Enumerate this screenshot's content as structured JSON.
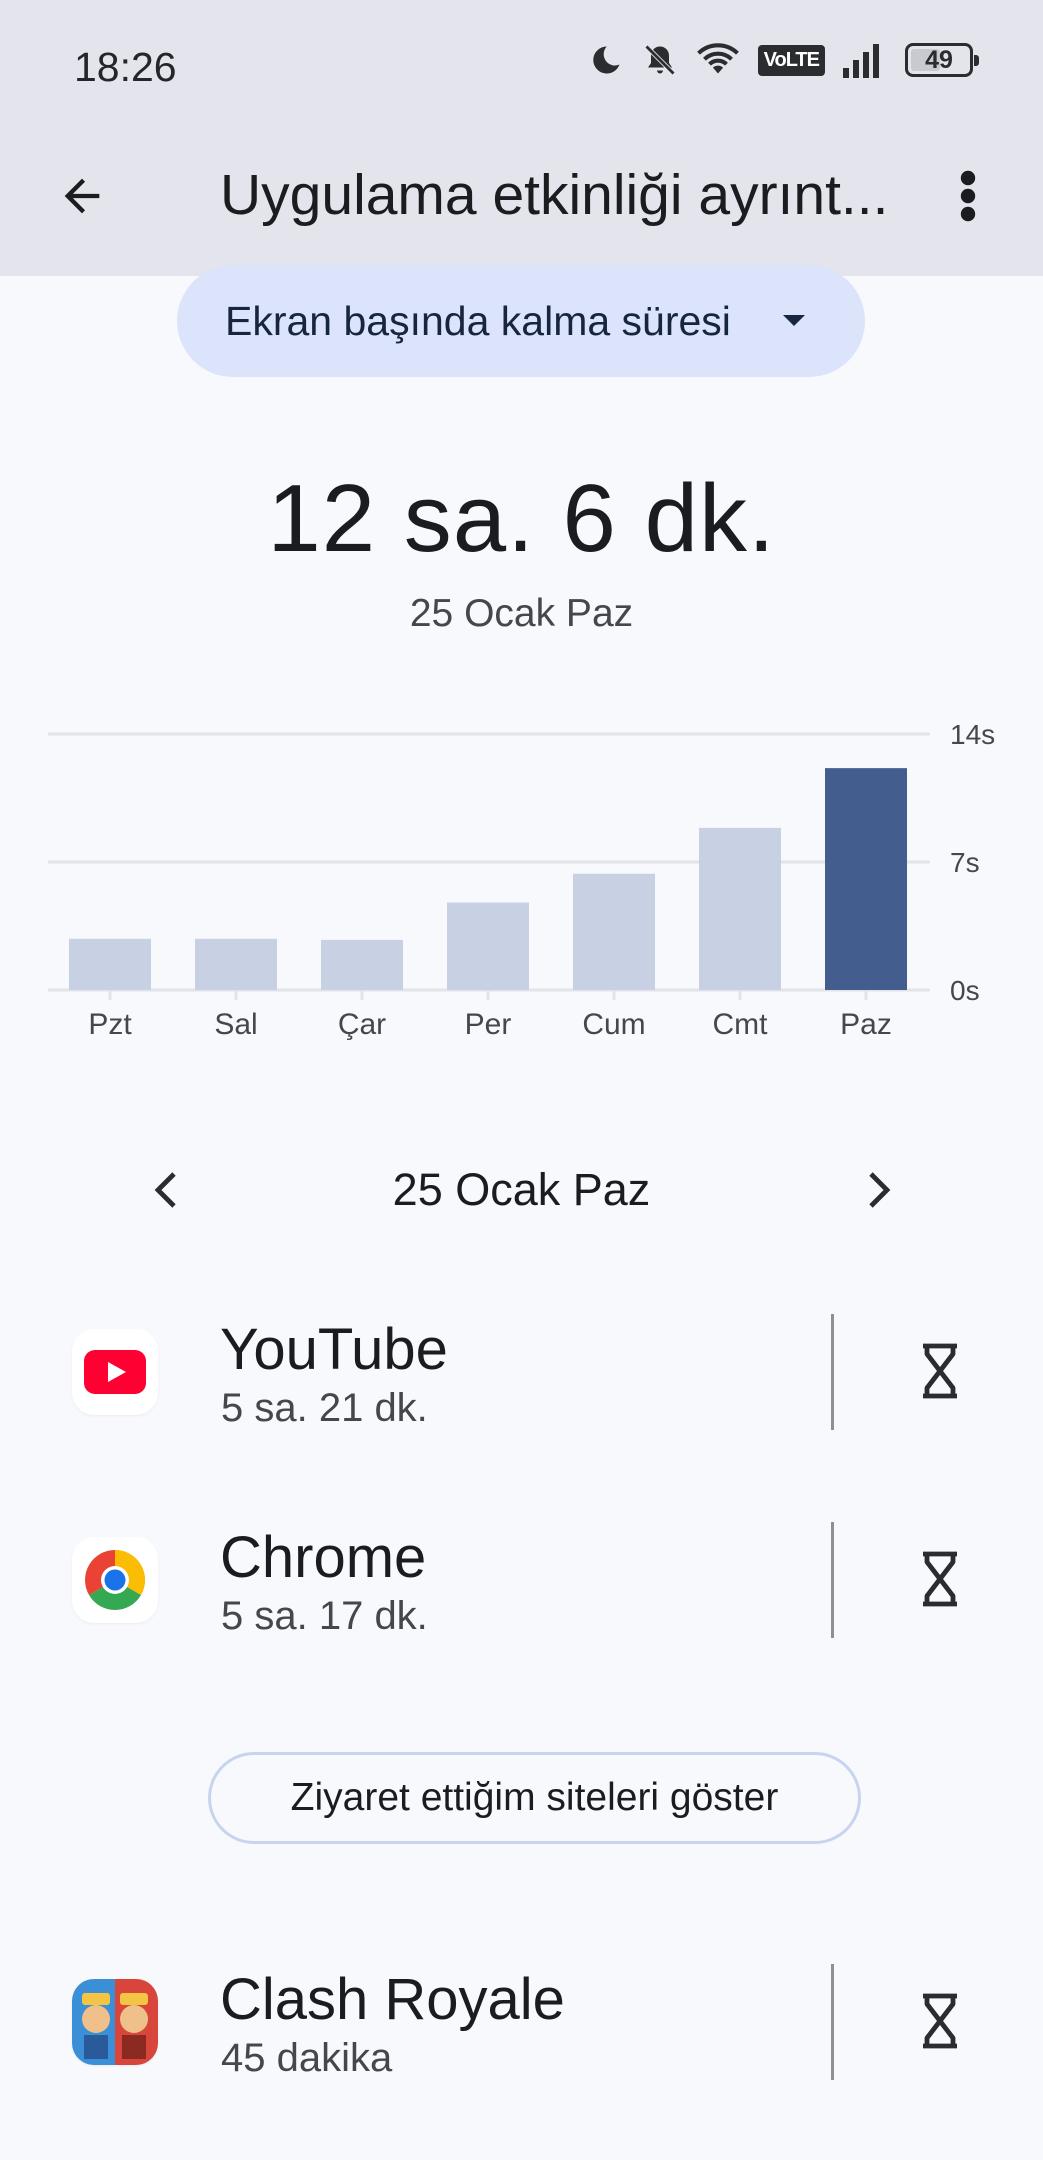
{
  "status_bar": {
    "time": "18:26",
    "network": "VoLTE",
    "battery": "49",
    "icons": [
      "moon-icon",
      "bell-off-icon",
      "wifi-icon",
      "volte-icon",
      "signal-icon",
      "battery-icon"
    ]
  },
  "header": {
    "title": "Uygulama etkinliği ayrınt...",
    "back_icon": "arrow-back-icon",
    "more_icon": "more-vert-icon"
  },
  "metric_selector": {
    "label": "Ekran başında kalma süresi",
    "icon": "arrow-drop-down-icon"
  },
  "summary": {
    "total": "12 sa. 6 dk.",
    "date": "25 Ocak Paz"
  },
  "chart_data": {
    "type": "bar",
    "categories": [
      "Pzt",
      "Sal",
      "Çar",
      "Per",
      "Cum",
      "Cmt",
      "Paz"
    ],
    "values": [
      2.4,
      2.4,
      2.35,
      4.1,
      5.45,
      7.6,
      10.4
    ],
    "ylim": [
      0,
      12
    ],
    "y_ticks": [
      {
        "value": 0,
        "label": "0s"
      },
      {
        "value": 6,
        "label": "7s"
      },
      {
        "value": 12,
        "label": "14s"
      }
    ],
    "highlight_index": 6,
    "colors": {
      "bar": "#c7d1e3",
      "highlight": "#435d8f",
      "grid": "#e2e4ea",
      "tick_label": "#45474d"
    },
    "grid": true
  },
  "date_nav": {
    "label": "25 Ocak Paz",
    "prev_icon": "chevron-left-icon",
    "next_icon": "chevron-right-icon"
  },
  "apps": [
    {
      "name": "YouTube",
      "time": "5 sa. 21 dk.",
      "icon": "youtube-icon",
      "timer_icon": "hourglass-icon"
    },
    {
      "name": "Chrome",
      "time": "5 sa. 17 dk.",
      "icon": "chrome-icon",
      "timer_icon": "hourglass-icon"
    },
    {
      "name": "Clash Royale",
      "time": "45 dakika",
      "icon": "clash-royale-icon",
      "timer_icon": "hourglass-icon"
    }
  ],
  "sites_button": {
    "label": "Ziyaret ettiğim siteleri göster"
  }
}
